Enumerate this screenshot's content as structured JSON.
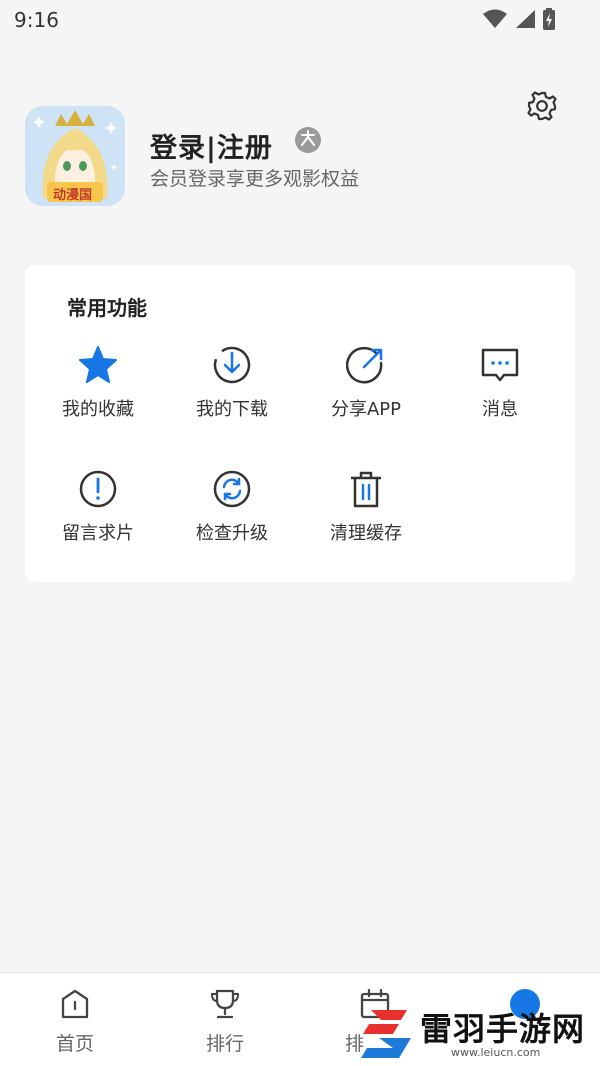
{
  "status_bar": {
    "time": "9:16"
  },
  "profile": {
    "title": "登录|注册",
    "subtitle": "会员登录享更多观影权益",
    "avatar_caption": "动漫国"
  },
  "functions": {
    "title": "常用功能",
    "items": [
      {
        "label": "我的收藏",
        "icon": "star-icon"
      },
      {
        "label": "我的下载",
        "icon": "download-icon"
      },
      {
        "label": "分享APP",
        "icon": "share-icon"
      },
      {
        "label": "消息",
        "icon": "message-icon"
      },
      {
        "label": "留言求片",
        "icon": "exclamation-icon"
      },
      {
        "label": "检查升级",
        "icon": "refresh-icon"
      },
      {
        "label": "清理缓存",
        "icon": "trash-icon"
      }
    ]
  },
  "tabbar": {
    "tabs": [
      {
        "label": "首页",
        "icon": "home-icon"
      },
      {
        "label": "排行",
        "icon": "trophy-icon"
      },
      {
        "label": "排",
        "icon": "calendar-icon"
      },
      {
        "label": "",
        "icon": "profile-icon"
      }
    ]
  },
  "watermark": {
    "text": "雷羽手游网",
    "url": "www.leiucn.com"
  },
  "colors": {
    "accent": "#1677e5",
    "icon_dark": "#333333",
    "background": "#f5f5f5"
  }
}
